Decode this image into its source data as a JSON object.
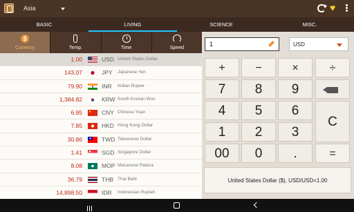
{
  "statusbar": {
    "region": "Asia"
  },
  "tabs": [
    {
      "label": "BASIC"
    },
    {
      "label": "LIVING"
    },
    {
      "label": "SCIENCE"
    },
    {
      "label": "MISC."
    }
  ],
  "categories": [
    {
      "label": "Currency"
    },
    {
      "label": "Temp."
    },
    {
      "label": "Time"
    },
    {
      "label": "Speed"
    }
  ],
  "rows": [
    {
      "amount": "1.00",
      "code": "USD",
      "name": "United States Dollar"
    },
    {
      "amount": "143.07",
      "code": "JPY",
      "name": "Japanese Yen"
    },
    {
      "amount": "79.90",
      "code": "INR",
      "name": "Indian Rupee"
    },
    {
      "amount": "1,384.82",
      "code": "KRW",
      "name": "South Korean Won"
    },
    {
      "amount": "6.95",
      "code": "CNY",
      "name": "Chinese Yuan"
    },
    {
      "amount": "7.85",
      "code": "HKD",
      "name": "Hong Kong Dollar"
    },
    {
      "amount": "30.86",
      "code": "TWD",
      "name": "Taiwanese Dollar"
    },
    {
      "amount": "1.41",
      "code": "SGD",
      "name": "Singapore Dollar"
    },
    {
      "amount": "8.08",
      "code": "MOP",
      "name": "Macanese Pataca"
    },
    {
      "amount": "36.79",
      "code": "THB",
      "name": "Thai Baht"
    },
    {
      "amount": "14,898.50",
      "code": "IDR",
      "name": "Indonesian Rupiah"
    }
  ],
  "calculator": {
    "input_value": "1",
    "currency": "USD",
    "keys": {
      "plus": "+",
      "minus": "−",
      "times": "×",
      "divide": "÷",
      "seven": "7",
      "eight": "8",
      "nine": "9",
      "four": "4",
      "five": "5",
      "six": "6",
      "one": "1",
      "two": "2",
      "three": "3",
      "clear": "C",
      "double_zero": "00",
      "zero": "0",
      "dot": ".",
      "equals": "="
    },
    "result": "United States Dollar ($), USD/USD=1.00"
  }
}
